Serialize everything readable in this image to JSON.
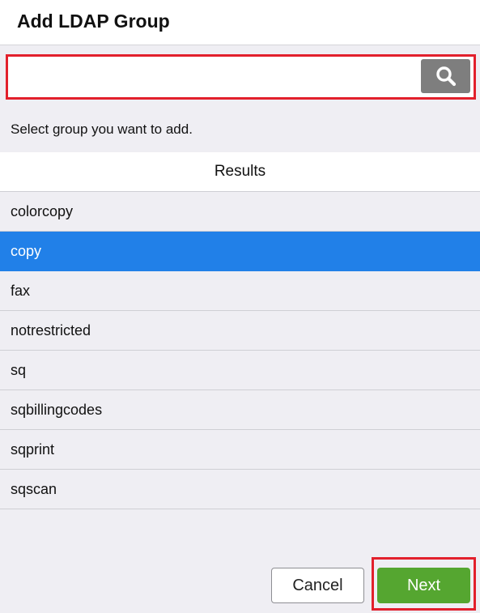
{
  "header": {
    "title": "Add LDAP Group"
  },
  "search": {
    "value": "",
    "placeholder": "",
    "icon": "search-icon"
  },
  "instruction": "Select group you want to add.",
  "results": {
    "header": "Results",
    "items": [
      {
        "label": "colorcopy",
        "selected": false
      },
      {
        "label": "copy",
        "selected": true
      },
      {
        "label": "fax",
        "selected": false
      },
      {
        "label": "notrestricted",
        "selected": false
      },
      {
        "label": "sq",
        "selected": false
      },
      {
        "label": "sqbillingcodes",
        "selected": false
      },
      {
        "label": "sqprint",
        "selected": false
      },
      {
        "label": "sqscan",
        "selected": false
      }
    ]
  },
  "footer": {
    "cancel_label": "Cancel",
    "next_label": "Next"
  },
  "colors": {
    "selected": "#2180e8",
    "next": "#55a630",
    "highlight_border": "#e2202c"
  }
}
